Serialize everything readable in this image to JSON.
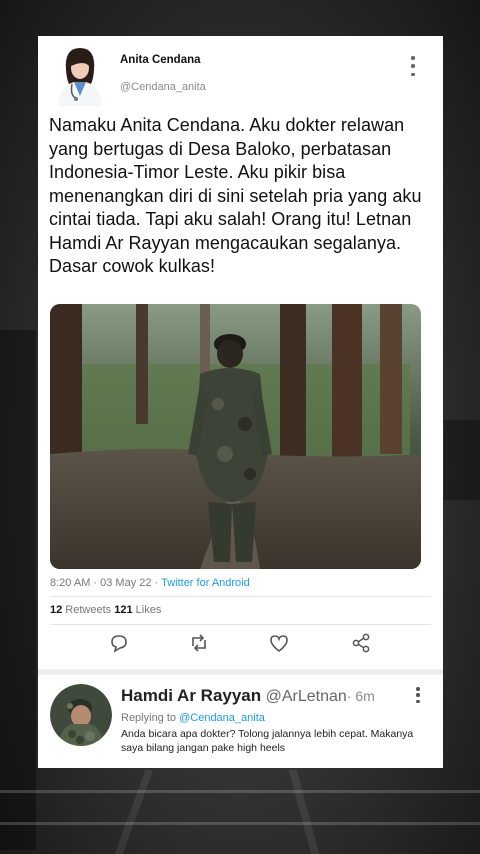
{
  "tweet": {
    "author_name": "Anita Cendana",
    "author_handle": "@Cendana_anita",
    "text": "Namaku Anita Cendana. Aku dokter relawan yang bertugas di Desa Baloko, perbatasan Indonesia-Timor Leste. Aku pikir bisa menenangkan diri di sini setelah pria yang aku cintai tiada. Tapi aku salah! Orang itu! Letnan Hamdi Ar Rayyan mengacaukan segalanya. Dasar cowok kulkas!",
    "timestamp": "8:20 AM · 03 May 22 · ",
    "source": "Twitter for Android",
    "retweets_count": "12",
    "retweets_label": " Retweets ",
    "likes_count": "121",
    "likes_label": " Likes"
  },
  "actions": {
    "reply_icon": "reply-icon",
    "retweet_icon": "retweet-icon",
    "like_icon": "heart-icon",
    "share_icon": "share-icon"
  },
  "reply": {
    "author_name": "Hamdi Ar Rayyan",
    "author_handle": " @ArLetnan",
    "time": "· 6m",
    "replying_prefix": "Replying to ",
    "replying_to": "@Cendana_anita",
    "text": "Anda bicara apa dokter? Tolong jalannya lebih cepat. Makanya saya bilang jangan pake high heels"
  },
  "colors": {
    "link": "#1d9bf0",
    "card_bg": "#ffffff",
    "page_bg": "#333333"
  }
}
